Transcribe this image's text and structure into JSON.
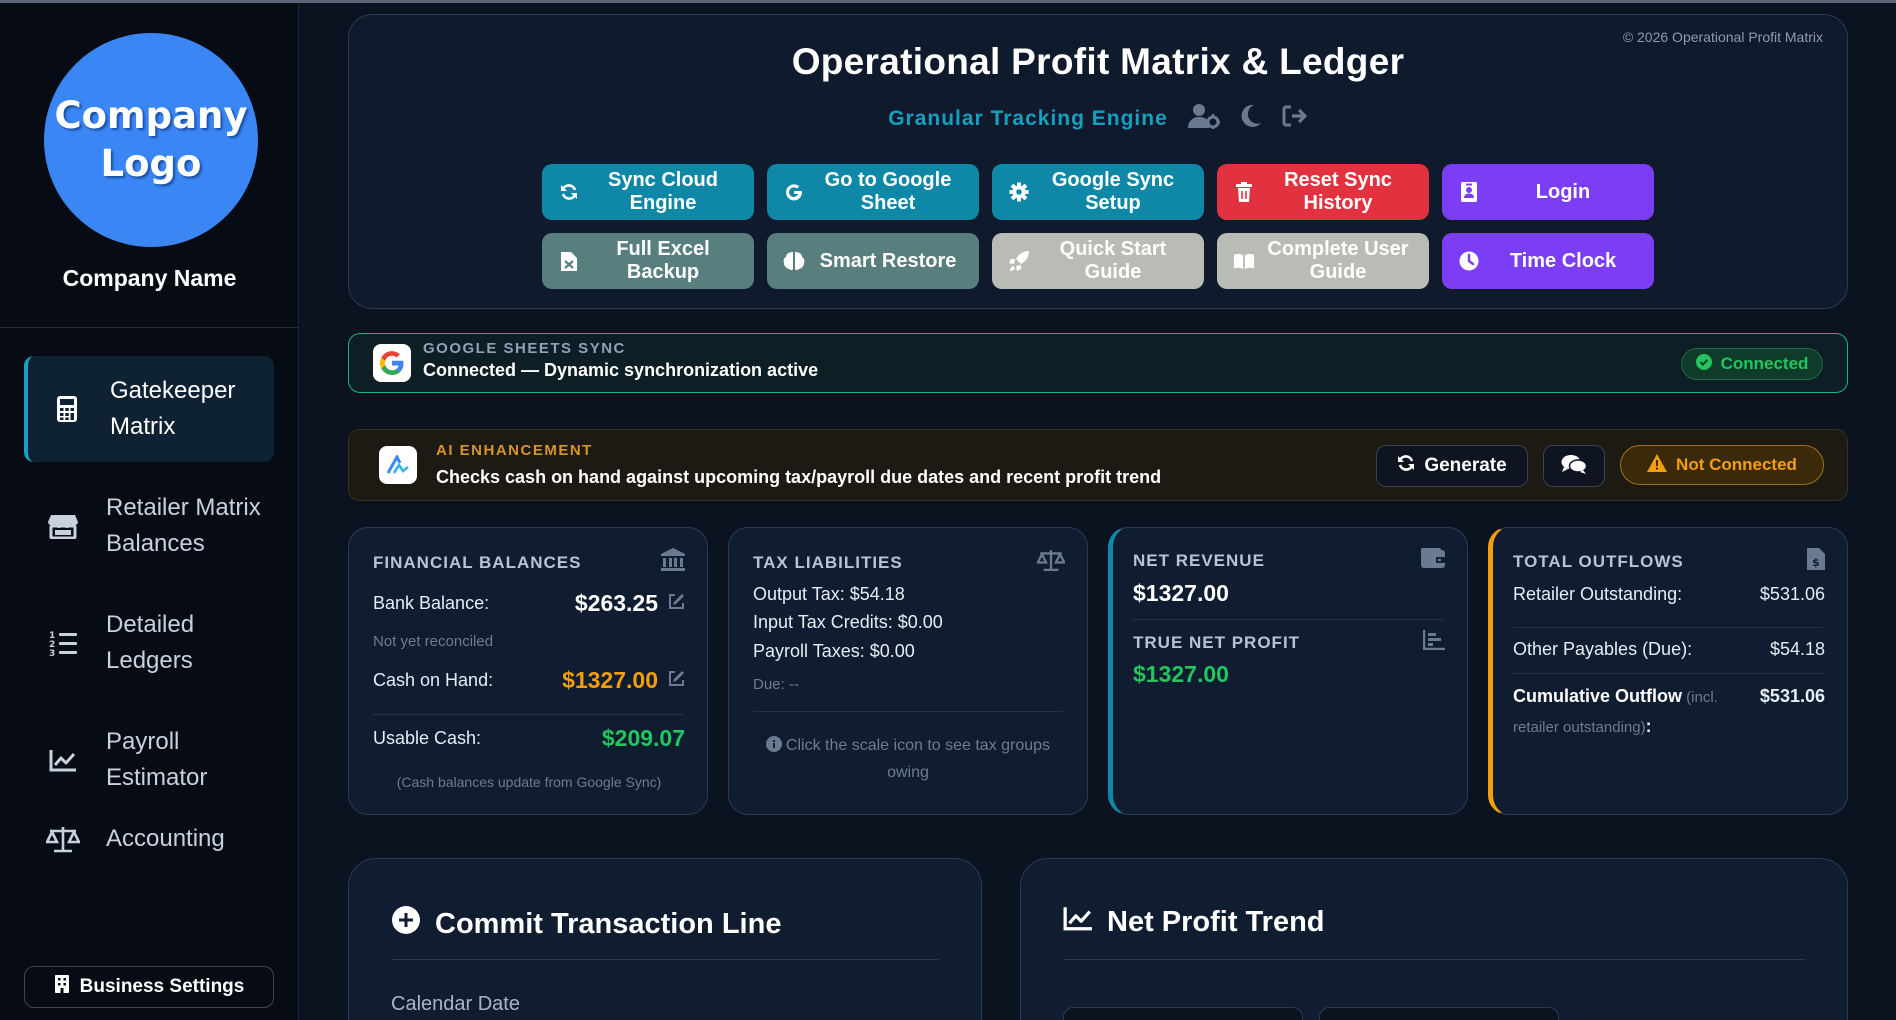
{
  "sidebar": {
    "logo_text": "Company\nLogo",
    "company_name": "Company Name",
    "items": [
      {
        "label": "Gatekeeper\nMatrix",
        "icon": "calculator-icon"
      },
      {
        "label": "Retailer Matrix\nBalances",
        "icon": "store-icon"
      },
      {
        "label": "Detailed\nLedgers",
        "icon": "list-icon"
      },
      {
        "label": "Payroll\nEstimator",
        "icon": "line-chart-icon"
      },
      {
        "label": "Accounting",
        "icon": "scale-icon"
      }
    ],
    "settings_label": "Business Settings"
  },
  "header": {
    "copyright": "© 2026 Operational Profit Matrix",
    "title": "Operational Profit Matrix & Ledger",
    "subtitle": "Granular Tracking Engine",
    "buttons": [
      {
        "label": "Sync Cloud\nEngine",
        "icon": "sync-icon",
        "style": "teal"
      },
      {
        "label": "Go to Google\nSheet",
        "icon": "google-icon",
        "style": "teal"
      },
      {
        "label": "Google Sync\nSetup",
        "icon": "gear-icon",
        "style": "teal"
      },
      {
        "label": "Reset Sync\nHistory",
        "icon": "trash-icon",
        "style": "red"
      },
      {
        "label": "Login",
        "icon": "id-badge-icon",
        "style": "purple"
      },
      {
        "label": "Full Excel\nBackup",
        "icon": "excel-file-icon",
        "style": "slate"
      },
      {
        "label": "Smart Restore",
        "icon": "brain-icon",
        "style": "slate"
      },
      {
        "label": "Quick Start\nGuide",
        "icon": "rocket-icon",
        "style": "grey"
      },
      {
        "label": "Complete User\nGuide",
        "icon": "book-icon",
        "style": "grey"
      },
      {
        "label": "Time Clock",
        "icon": "clock-icon",
        "style": "purple"
      }
    ]
  },
  "sync": {
    "kicker": "GOOGLE SHEETS SYNC",
    "text": "Connected — Dynamic synchronization active",
    "status": "Connected"
  },
  "ai": {
    "kicker": "AI ENHANCEMENT",
    "text": "Checks cash on hand against upcoming tax/payroll due dates and recent profit trend",
    "generate_label": "Generate",
    "status": "Not Connected"
  },
  "cards": {
    "financial": {
      "title": "FINANCIAL BALANCES",
      "bank_label": "Bank Balance:",
      "bank_value": "$263.25",
      "bank_note": "Not yet reconciled",
      "cash_label": "Cash on Hand:",
      "cash_value": "$1327.00",
      "usable_label": "Usable Cash:",
      "usable_value": "$209.07",
      "footnote": "(Cash balances update from Google Sync)"
    },
    "tax": {
      "title": "TAX LIABILITIES",
      "output": "Output Tax: $54.18",
      "input": "Input Tax Credits: $0.00",
      "payroll": "Payroll Taxes: $0.00",
      "due": "Due: --",
      "hint": "Click the scale icon to see tax groups owing"
    },
    "revenue": {
      "title": "NET REVENUE",
      "value": "$1327.00",
      "profit_title": "TRUE NET PROFIT",
      "profit_value": "$1327.00"
    },
    "outflows": {
      "title": "TOTAL OUTFLOWS",
      "retailer_label": "Retailer Outstanding:",
      "retailer_value": "$531.06",
      "payables_label": "Other Payables (Due):",
      "payables_value": "$54.18",
      "cumulative_label": "Cumulative Outflow",
      "cumulative_incl": " (incl.",
      "cumulative_incl2": "retailer outstanding)",
      "cumulative_colon": ":",
      "cumulative_value": "$531.06"
    }
  },
  "commit": {
    "title": "Commit Transaction Line",
    "field_label": "Calendar Date"
  },
  "trend": {
    "title": "Net Profit Trend"
  },
  "colors": {
    "accent_teal": "#0f88a8",
    "danger": "#e2323f",
    "purple": "#7b3ef5",
    "success": "#22c55e",
    "warning": "#f59e0b"
  }
}
